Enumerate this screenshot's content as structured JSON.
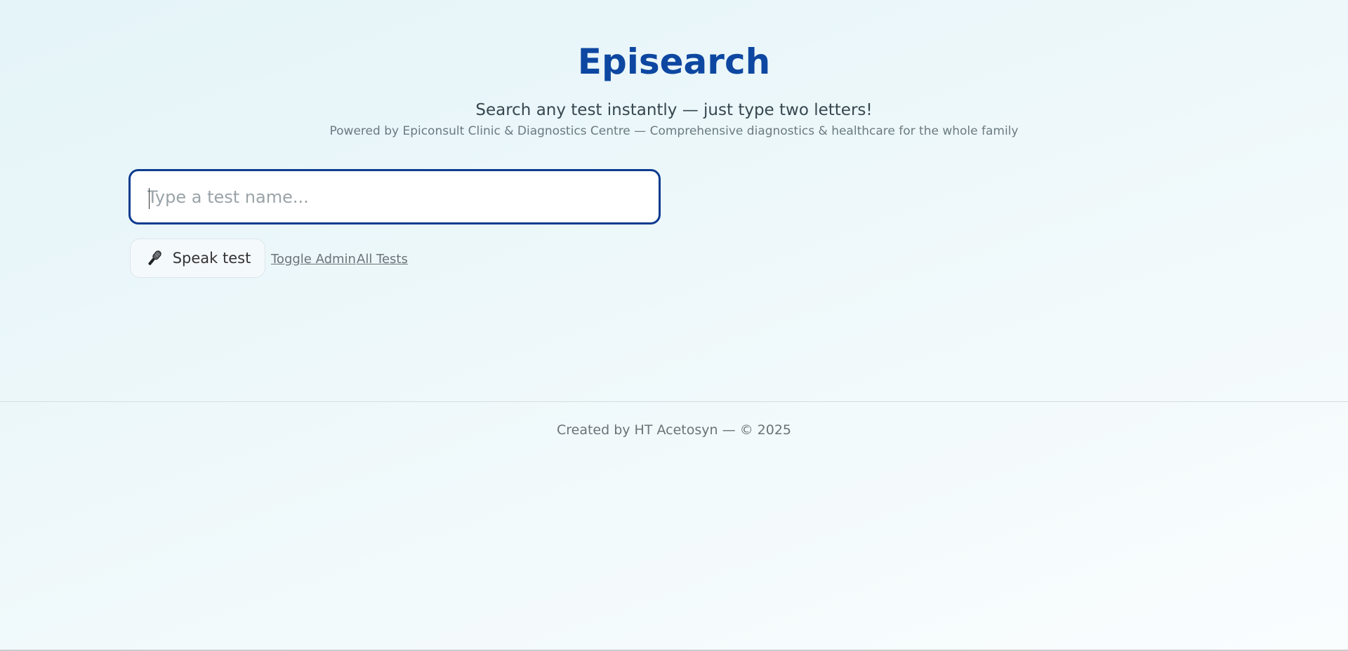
{
  "header": {
    "title": "Episearch",
    "tagline": "Search any test instantly — just type two letters!",
    "powered_by": "Powered by Epiconsult Clinic & Diagnostics Centre — Comprehensive diagnostics & healthcare for the whole family"
  },
  "search": {
    "placeholder": "Type a test name...",
    "value": ""
  },
  "actions": {
    "speak_label": "Speak test",
    "speak_icon": "microphone-icon",
    "toggle_admin": "Toggle Admin",
    "all_tests": "All Tests"
  },
  "footer": {
    "text": "Created by HT Acetosyn — © 2025"
  },
  "colors": {
    "accent": "#0d47a1",
    "input_border": "#0d3b8f",
    "background_start": "#e4f4f8",
    "background_end": "#fafdfe"
  }
}
